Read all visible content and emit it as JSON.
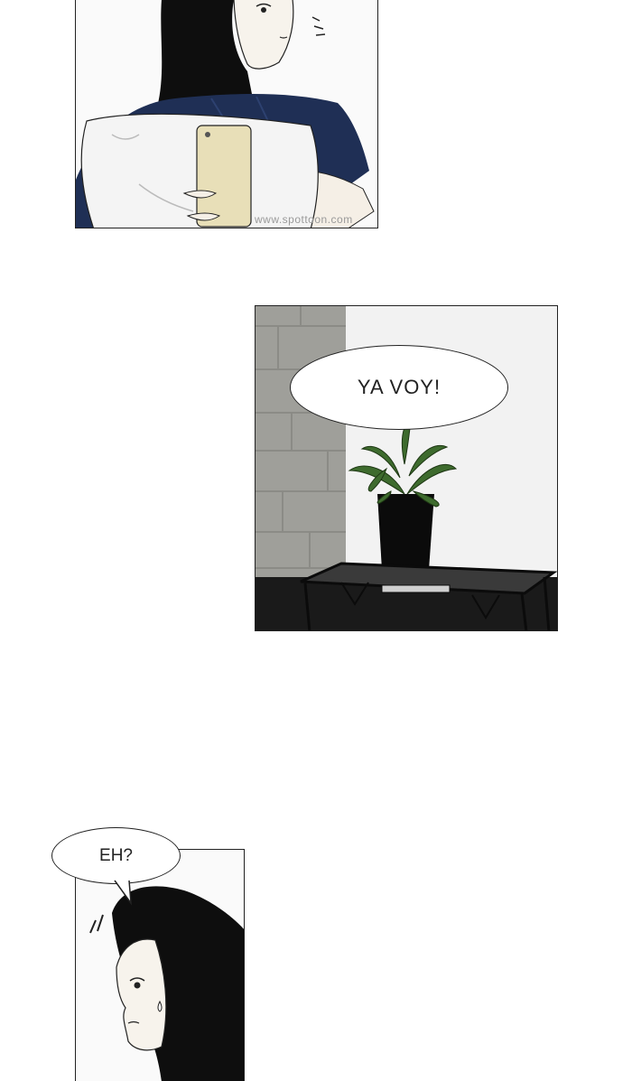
{
  "panels": {
    "top": {
      "watermark": "www.spottoon.com"
    },
    "middle": {
      "speech": "YA VOY!"
    },
    "bottom": {
      "speech": "EH?"
    }
  },
  "colors": {
    "page_background": "#ffffff",
    "shirt_navy": "#1f2f55",
    "hair_black": "#0e0e0e",
    "phone_cream": "#e8dfb8",
    "wall_stone": "#9a9a95",
    "plant_green": "#3e6b2e"
  }
}
